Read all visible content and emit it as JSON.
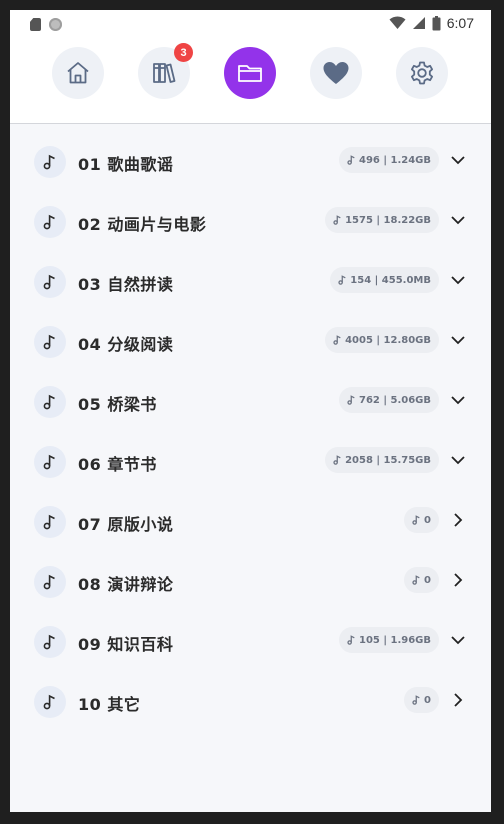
{
  "status_bar": {
    "time": "6:07",
    "left_icons": [
      "sd-card-icon",
      "circle-icon"
    ],
    "right_icons": [
      "wifi-icon",
      "signal-icon",
      "battery-icon"
    ]
  },
  "nav": {
    "items": [
      {
        "name": "home",
        "icon": "home-icon",
        "active": false
      },
      {
        "name": "library",
        "icon": "books-icon",
        "active": false,
        "badge": "3"
      },
      {
        "name": "folder",
        "icon": "folder-icon",
        "active": true
      },
      {
        "name": "favorites",
        "icon": "heart-icon",
        "active": false
      },
      {
        "name": "settings",
        "icon": "gear-icon",
        "active": false
      }
    ],
    "accent_color": "#9333ea",
    "badge_color": "#ef4444"
  },
  "folders": [
    {
      "title": "01 歌曲歌谣",
      "stats": "496 | 1.24GB",
      "expanded": true
    },
    {
      "title": "02 动画片与电影",
      "stats": "1575 | 18.22GB",
      "expanded": true
    },
    {
      "title": "03 自然拼读",
      "stats": "154 | 455.0MB",
      "expanded": true
    },
    {
      "title": "04 分级阅读",
      "stats": "4005 | 12.80GB",
      "expanded": true
    },
    {
      "title": "05 桥梁书",
      "stats": "762 | 5.06GB",
      "expanded": true
    },
    {
      "title": "06 章节书",
      "stats": "2058 | 15.75GB",
      "expanded": true
    },
    {
      "title": "07 原版小说",
      "stats": "0",
      "expanded": false
    },
    {
      "title": "08 演讲辩论",
      "stats": "0",
      "expanded": false
    },
    {
      "title": "09 知识百科",
      "stats": "105 | 1.96GB",
      "expanded": true
    },
    {
      "title": "10 其它",
      "stats": "0",
      "expanded": false
    }
  ]
}
